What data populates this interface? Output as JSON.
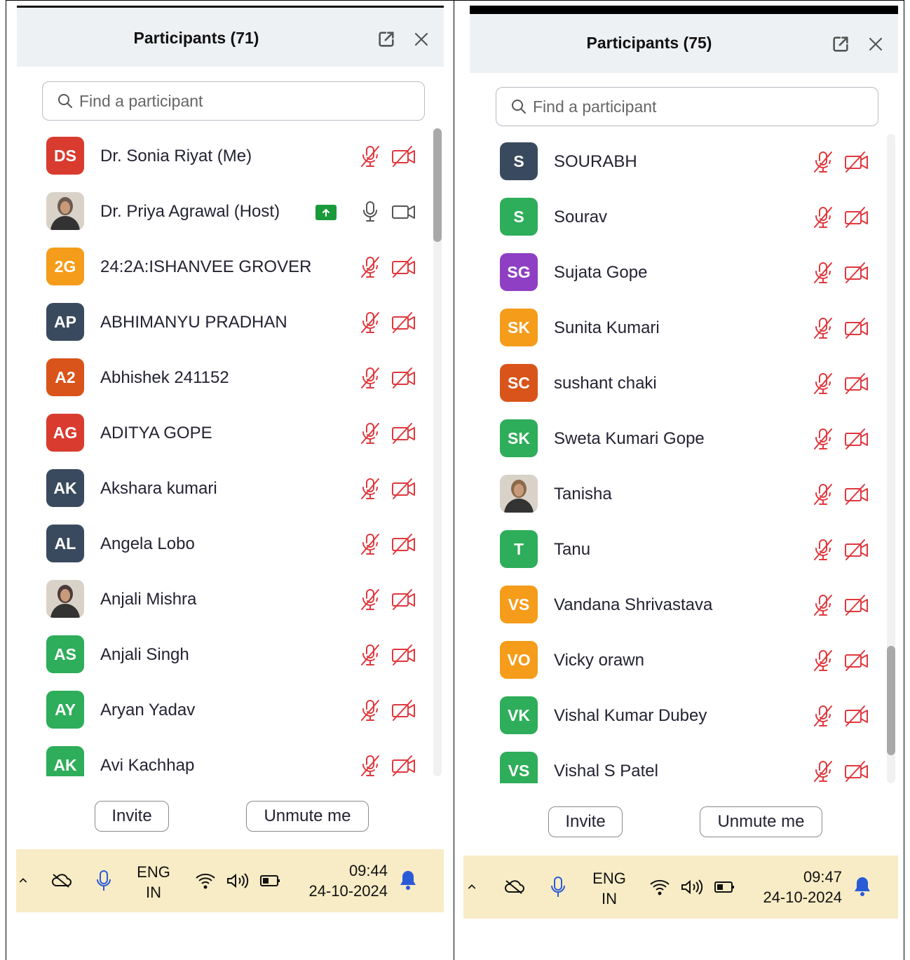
{
  "panels": [
    {
      "title": "Participants (71)",
      "search_placeholder": "Find a participant",
      "participants": [
        {
          "initials": "DS",
          "name": "Dr. Sonia Riyat (Me)",
          "color": "#d93b2f",
          "photo": false,
          "mic": "muted",
          "video": "off"
        },
        {
          "initials": "",
          "name": "Dr. Priya Agrawal (Host)",
          "color": "#6b5b4f",
          "photo": true,
          "mic": "on",
          "video": "on",
          "sharing": true
        },
        {
          "initials": "2G",
          "name": "24:2A:ISHANVEE GROVER",
          "color": "#f59c1a",
          "photo": false,
          "mic": "muted",
          "video": "off"
        },
        {
          "initials": "AP",
          "name": "ABHIMANYU PRADHAN",
          "color": "#3a4a5e",
          "photo": false,
          "mic": "muted",
          "video": "off"
        },
        {
          "initials": "A2",
          "name": "Abhishek 241152",
          "color": "#d9541a",
          "photo": false,
          "mic": "muted",
          "video": "off"
        },
        {
          "initials": "AG",
          "name": "ADITYA  GOPE",
          "color": "#d93b2f",
          "photo": false,
          "mic": "muted",
          "video": "off"
        },
        {
          "initials": "AK",
          "name": "Akshara kumari",
          "color": "#3a4a5e",
          "photo": false,
          "mic": "muted",
          "video": "off"
        },
        {
          "initials": "AL",
          "name": "Angela Lobo",
          "color": "#3a4a5e",
          "photo": false,
          "mic": "muted",
          "video": "off"
        },
        {
          "initials": "",
          "name": "Anjali Mishra",
          "color": "#4b3b3b",
          "photo": true,
          "mic": "muted",
          "video": "off"
        },
        {
          "initials": "AS",
          "name": "Anjali Singh",
          "color": "#2ead5a",
          "photo": false,
          "mic": "muted",
          "video": "off"
        },
        {
          "initials": "AY",
          "name": "Aryan Yadav",
          "color": "#2ead5a",
          "photo": false,
          "mic": "muted",
          "video": "off"
        },
        {
          "initials": "AK",
          "name": "Avi Kachhap",
          "color": "#2ead5a",
          "photo": false,
          "mic": "muted",
          "video": "off"
        }
      ],
      "buttons": {
        "invite": "Invite",
        "unmute": "Unmute me"
      },
      "taskbar": {
        "lang": "ENG",
        "region": "IN",
        "time": "09:44",
        "date": "24-10-2024"
      }
    },
    {
      "title": "Participants (75)",
      "search_placeholder": "Find a participant",
      "participants": [
        {
          "initials": "S",
          "name": "SOURABH",
          "color": "#3a4a5e",
          "photo": false,
          "mic": "muted",
          "video": "off"
        },
        {
          "initials": "S",
          "name": "Sourav",
          "color": "#2ead5a",
          "photo": false,
          "mic": "muted",
          "video": "off"
        },
        {
          "initials": "SG",
          "name": "Sujata Gope",
          "color": "#8e3fc4",
          "photo": false,
          "mic": "muted",
          "video": "off"
        },
        {
          "initials": "SK",
          "name": "Sunita Kumari",
          "color": "#f59c1a",
          "photo": false,
          "mic": "muted",
          "video": "off"
        },
        {
          "initials": "SC",
          "name": "sushant chaki",
          "color": "#d9541a",
          "photo": false,
          "mic": "muted",
          "video": "off"
        },
        {
          "initials": "SK",
          "name": "Sweta Kumari Gope",
          "color": "#2ead5a",
          "photo": false,
          "mic": "muted",
          "video": "off"
        },
        {
          "initials": "",
          "name": "Tanisha",
          "color": "#8b6a4a",
          "photo": true,
          "mic": "muted",
          "video": "off"
        },
        {
          "initials": "T",
          "name": "Tanu",
          "color": "#2ead5a",
          "photo": false,
          "mic": "muted",
          "video": "off"
        },
        {
          "initials": "VS",
          "name": "Vandana Shrivastava",
          "color": "#f59c1a",
          "photo": false,
          "mic": "muted",
          "video": "off"
        },
        {
          "initials": "VO",
          "name": "Vicky orawn",
          "color": "#f59c1a",
          "photo": false,
          "mic": "muted",
          "video": "off"
        },
        {
          "initials": "VK",
          "name": "Vishal Kumar Dubey",
          "color": "#2ead5a",
          "photo": false,
          "mic": "muted",
          "video": "off"
        },
        {
          "initials": "VS",
          "name": "Vishal S Patel",
          "color": "#2ead5a",
          "photo": false,
          "mic": "muted",
          "video": "off"
        }
      ],
      "buttons": {
        "invite": "Invite",
        "unmute": "Unmute me"
      },
      "taskbar": {
        "lang": "ENG",
        "region": "IN",
        "time": "09:47",
        "date": "24-10-2024"
      }
    }
  ]
}
